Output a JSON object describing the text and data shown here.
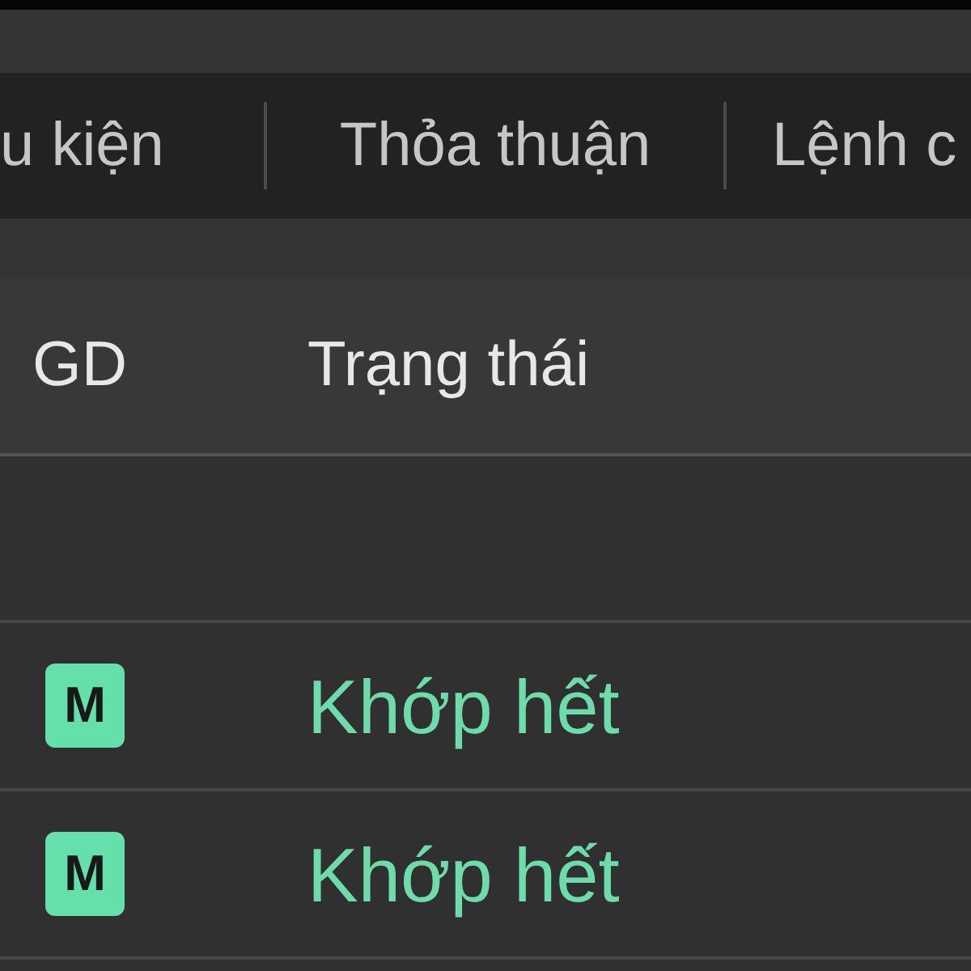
{
  "tabs": [
    {
      "label": "u kiện",
      "selected": false
    },
    {
      "label": "Thỏa thuận",
      "selected": false
    },
    {
      "label": "Lệnh c",
      "selected": false
    }
  ],
  "table": {
    "columns": [
      "GD",
      "Trạng thái"
    ],
    "rows": [
      {
        "badge": "M",
        "status": "Khớp hết"
      },
      {
        "badge": "M",
        "status": "Khớp hết"
      }
    ]
  }
}
